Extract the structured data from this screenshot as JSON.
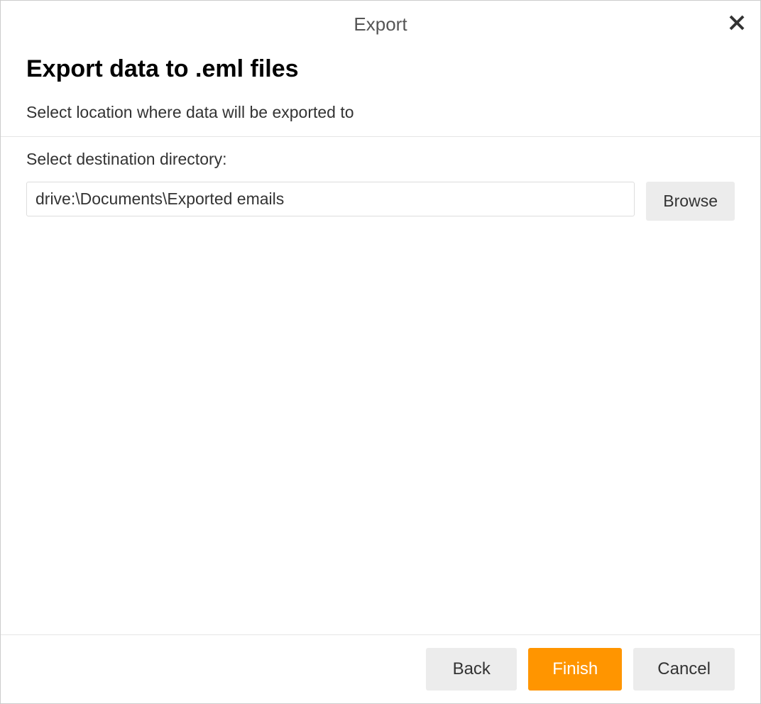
{
  "dialog": {
    "title": "Export",
    "close_icon": "✕"
  },
  "content": {
    "heading": "Export data to .eml files",
    "sub_heading": "Select location where data will be exported to",
    "field_label": "Select destination directory:",
    "path_value": "drive:\\Documents\\Exported emails",
    "browse_label": "Browse"
  },
  "footer": {
    "back_label": "Back",
    "finish_label": "Finish",
    "cancel_label": "Cancel"
  },
  "colors": {
    "accent": "#ff9500",
    "secondary_bg": "#ececec",
    "border": "#dddddd"
  }
}
